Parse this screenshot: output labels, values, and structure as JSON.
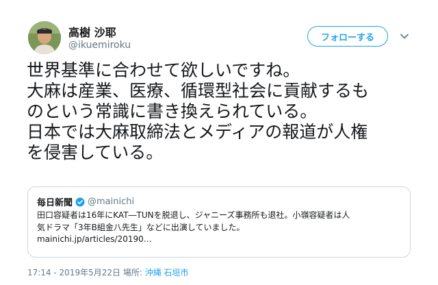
{
  "author": {
    "name": "高樹 沙耶",
    "handle": "@ikuemiroku"
  },
  "follow_button": {
    "label": "フォローする"
  },
  "menu": {
    "icon": "chevron-down-icon"
  },
  "tweet": {
    "lines": [
      "世界基準に合わせて欲しいですね。",
      "大麻は産業、医療、循環型社会に貢献するも",
      "のという常識に書き換えられている。",
      "日本では大麻取締法とメディアの報道が人権",
      "を侵害している。"
    ]
  },
  "quoted": {
    "name": "毎日新聞",
    "handle": "@mainichi",
    "verified_icon": "verified-badge-icon",
    "lines": [
      "田口容疑者は16年にKAT―TUNを脱退し、ジャニーズ事務所も退社。小嶺容疑者は人",
      "気ドラマ「3年B組金八先生」などに出演していました。"
    ],
    "link": "mainichi.jp/articles/20190…"
  },
  "meta": {
    "timestamp": "17:14 - 2019年5月22日",
    "place_label": "場所:",
    "location": "沖縄 石垣市"
  },
  "colors": {
    "accent": "#1da1f2",
    "muted": "#657786",
    "border": "#ccd6dd"
  }
}
